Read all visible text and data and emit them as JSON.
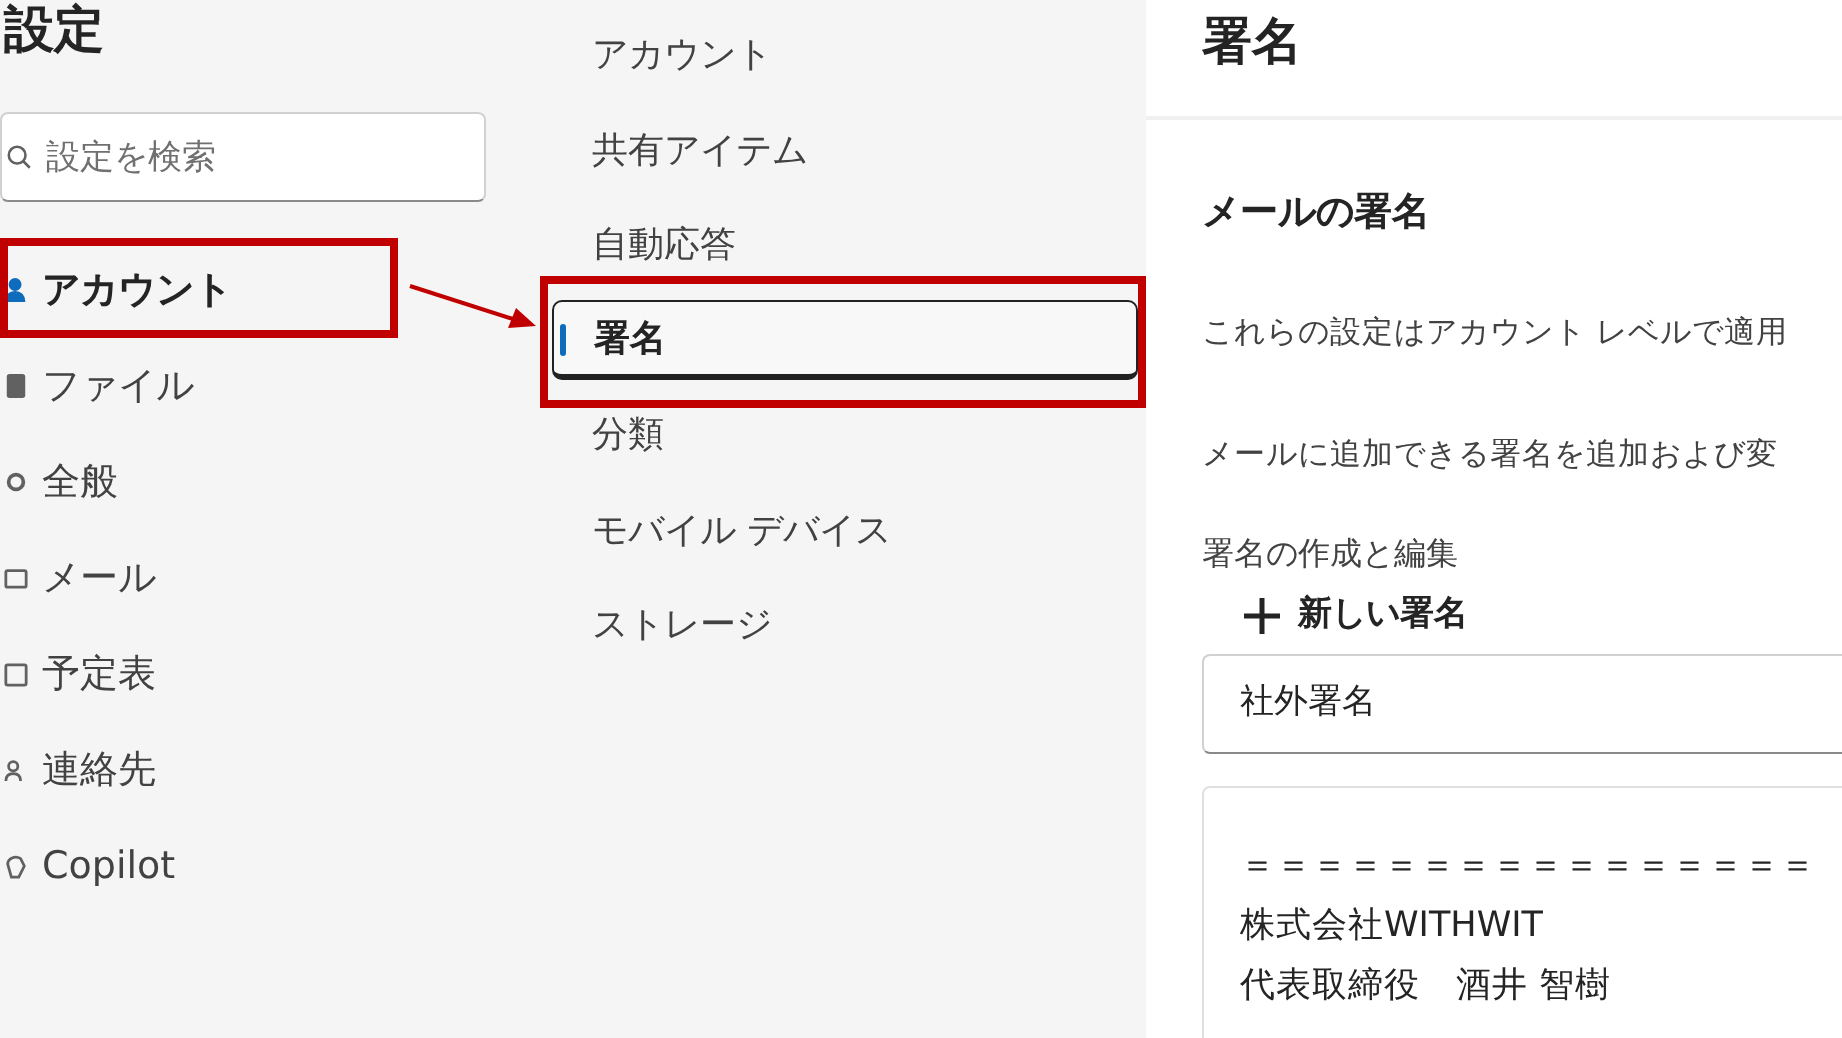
{
  "settings_panel": {
    "title": "設定",
    "search": {
      "placeholder": "設定を検索"
    },
    "items": [
      {
        "label": "アカウント",
        "selected": true,
        "highlighted": true
      },
      {
        "label": "ファイル",
        "selected": false,
        "highlighted": false
      },
      {
        "label": "全般",
        "selected": false,
        "highlighted": false
      },
      {
        "label": "メール",
        "selected": false,
        "highlighted": false
      },
      {
        "label": "予定表",
        "selected": false,
        "highlighted": false
      },
      {
        "label": "連絡先",
        "selected": false,
        "highlighted": false
      },
      {
        "label": "Copilot",
        "selected": false,
        "highlighted": false
      }
    ]
  },
  "annotation_arrow": true,
  "account_menu": {
    "items": [
      {
        "label": "アカウント",
        "selected": false,
        "highlighted": false
      },
      {
        "label": "共有アイテム",
        "selected": false,
        "highlighted": false
      },
      {
        "label": "自動応答",
        "selected": false,
        "highlighted": false
      },
      {
        "label": "署名",
        "selected": true,
        "highlighted": true
      },
      {
        "label": "分類",
        "selected": false,
        "highlighted": false
      },
      {
        "label": "モバイル デバイス",
        "selected": false,
        "highlighted": false
      },
      {
        "label": "ストレージ",
        "selected": false,
        "highlighted": false
      }
    ]
  },
  "signature_page": {
    "title": "署名",
    "section_title": "メールの署名",
    "notes": [
      "これらの設定はアカウント レベルで適用",
      "メールに追加できる署名を追加および変"
    ],
    "editor_label": "署名の作成と編集",
    "new_signature_button": "新しい署名",
    "signature_name": "社外署名",
    "signature_lines": [
      "＝＝＝＝＝＝＝＝＝＝＝＝＝＝＝＝",
      "株式会社WITHWIT",
      "代表取締役　酒井 智樹"
    ]
  }
}
